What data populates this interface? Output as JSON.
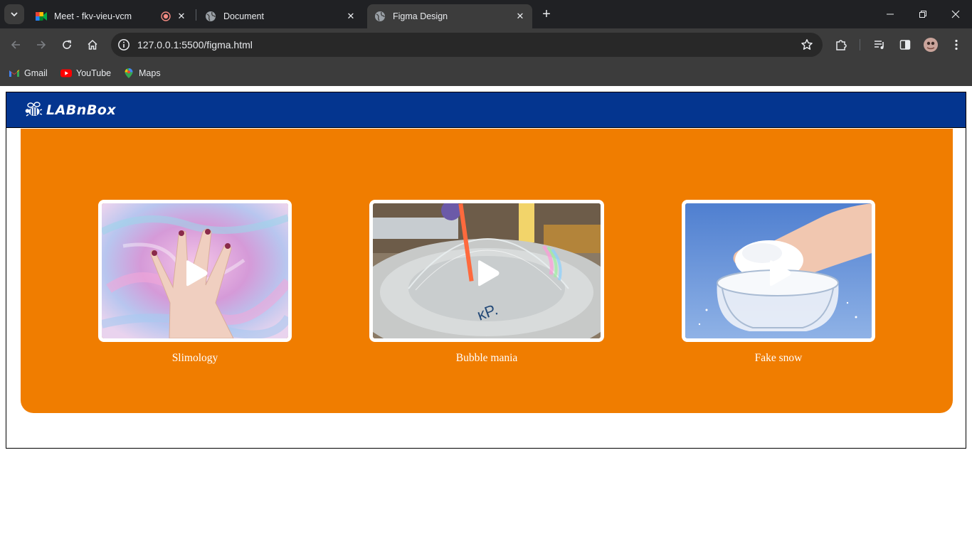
{
  "browser": {
    "tabs": [
      {
        "title": "Meet - fkv-vieu-vcm",
        "icon": "google-meet-icon",
        "recording": true,
        "active": false
      },
      {
        "title": "Document",
        "icon": "globe-icon",
        "active": false
      },
      {
        "title": "Figma Design",
        "icon": "globe-icon",
        "active": true
      }
    ],
    "url": "127.0.0.1:5500/figma.html",
    "bookmarks": [
      {
        "label": "Gmail",
        "icon": "gmail-icon"
      },
      {
        "label": "YouTube",
        "icon": "youtube-icon"
      },
      {
        "label": "Maps",
        "icon": "maps-icon"
      }
    ]
  },
  "site": {
    "brand": "LABnBox",
    "header_color": "#04358f",
    "panel_color": "#f07d00",
    "videos": [
      {
        "caption": "Slimology",
        "thumbnail": "pink and blue slime with hand",
        "icon": "play-icon"
      },
      {
        "caption": "Bubble mania",
        "thumbnail": "soap bubble dome over bowl",
        "icon": "play-icon"
      },
      {
        "caption": "Fake snow",
        "thumbnail": "hand holding fake snow over glass bowl",
        "icon": "play-icon"
      }
    ]
  }
}
